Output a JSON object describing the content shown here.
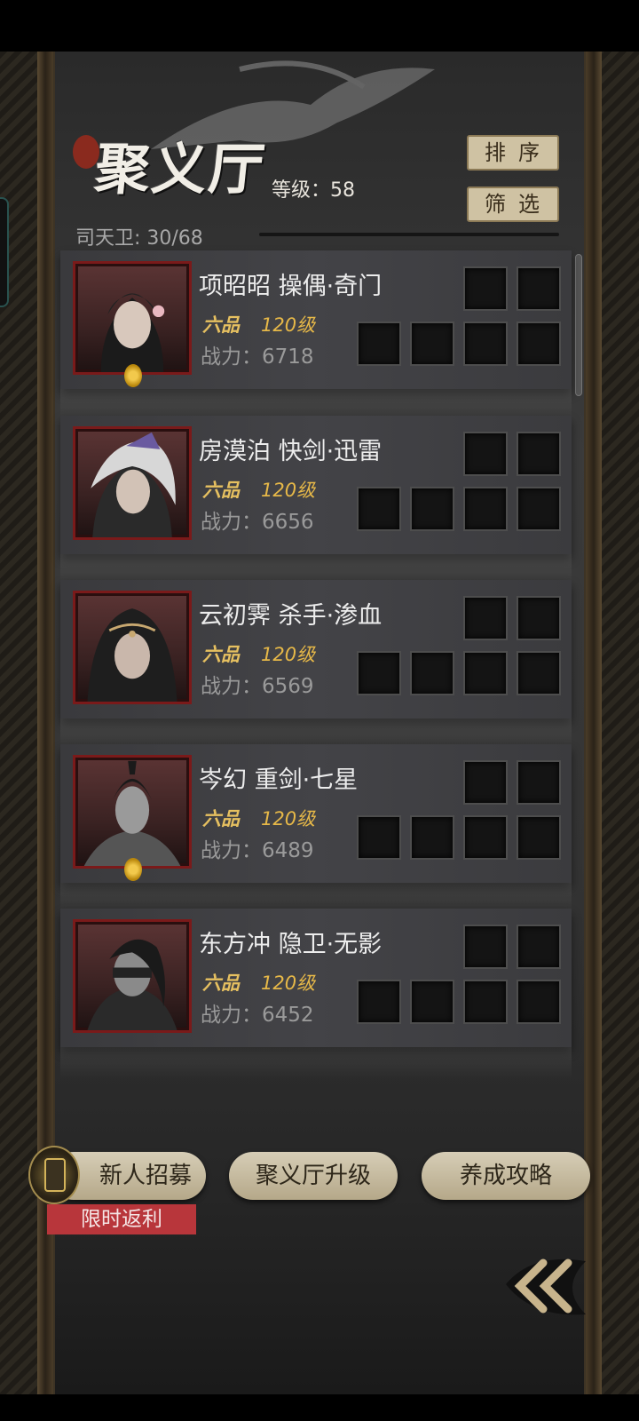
{
  "header": {
    "title": "聚义厅",
    "level_text": "等级：58",
    "guards_text": "司天卫: 30/68"
  },
  "toolbar": {
    "sort_label": "排序",
    "filter_label": "筛选"
  },
  "heroes": [
    {
      "name": "项昭昭   操偶·奇门",
      "rank": "六品",
      "level": "120级",
      "power": "战力：6718",
      "has_medal": true
    },
    {
      "name": "房漠泊   快剑·迅雷",
      "rank": "六品",
      "level": "120级",
      "power": "战力：6656",
      "has_medal": false
    },
    {
      "name": "云初霁   杀手·渗血",
      "rank": "六品",
      "level": "120级",
      "power": "战力：6569",
      "has_medal": false
    },
    {
      "name": "岑幻   重剑·七星",
      "rank": "六品",
      "level": "120级",
      "power": "战力：6489",
      "has_medal": true
    },
    {
      "name": "东方冲   隐卫·无影",
      "rank": "六品",
      "level": "120级",
      "power": "战力：6452",
      "has_medal": false
    }
  ],
  "bottom": {
    "recruit_label": "新人招募",
    "promo_label": "限时返利",
    "upgrade_label": "聚义厅升级",
    "guide_label": "养成攻略"
  },
  "icons": {
    "back": "double-chevron-left-icon",
    "medal": "gold-medal-icon",
    "recruit": "recruit-token-icon"
  },
  "colors": {
    "accent_gold": "#e6b848",
    "button_beige": "#cfc2a3",
    "portrait_border": "#7a1a1a",
    "promo_red": "#b8363b"
  }
}
